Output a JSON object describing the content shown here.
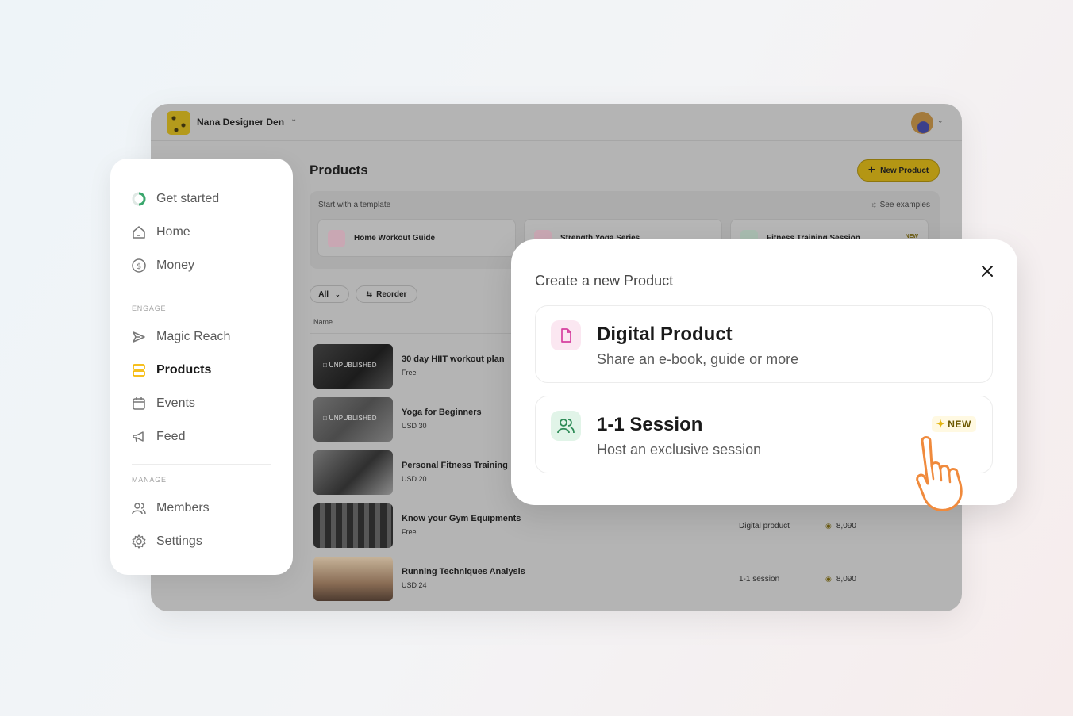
{
  "workspace": {
    "name": "Nana Designer Den"
  },
  "header": {
    "new_product_label": "New Product"
  },
  "page": {
    "title": "Products"
  },
  "templates": {
    "label": "Start with a template",
    "see_examples": "See examples",
    "items": [
      {
        "label": "Home Workout Guide",
        "badge": ""
      },
      {
        "label": "Strength Yoga Series",
        "badge": ""
      },
      {
        "label": "Fitness Training Session",
        "badge": "NEW"
      }
    ]
  },
  "filters": {
    "all_label": "All",
    "reorder_label": "Reorder"
  },
  "table": {
    "name_header": "Name",
    "rows": [
      {
        "title": "30 day HIIT workout plan",
        "price": "Free",
        "status": "UNPUBLISHED",
        "type": "",
        "views": ""
      },
      {
        "title": "Yoga for Beginners",
        "price": "USD 30",
        "status": "UNPUBLISHED",
        "type": "",
        "views": ""
      },
      {
        "title": "Personal Fitness Training",
        "price": "USD 20",
        "status": "",
        "type": "",
        "views": ""
      },
      {
        "title": "Know your Gym Equipments",
        "price": "Free",
        "status": "",
        "type": "Digital product",
        "views": "8,090"
      },
      {
        "title": "Running Techniques Analysis",
        "price": "USD 24",
        "status": "",
        "type": "1-1 session",
        "views": "8,090"
      }
    ]
  },
  "sidebar": {
    "items": [
      {
        "label": "Get started",
        "icon": "progress-icon"
      },
      {
        "label": "Home",
        "icon": "home-icon"
      },
      {
        "label": "Money",
        "icon": "dollar-icon"
      }
    ],
    "engage_label": "ENGAGE",
    "engage_items": [
      {
        "label": "Magic Reach",
        "icon": "send-icon"
      },
      {
        "label": "Products",
        "icon": "products-icon",
        "active": true
      },
      {
        "label": "Events",
        "icon": "calendar-icon"
      },
      {
        "label": "Feed",
        "icon": "megaphone-icon"
      }
    ],
    "manage_label": "MANAGE",
    "manage_items": [
      {
        "label": "Members",
        "icon": "users-icon"
      },
      {
        "label": "Settings",
        "icon": "gear-icon"
      }
    ]
  },
  "modal": {
    "title": "Create a new Product",
    "options": [
      {
        "title": "Digital Product",
        "subtitle": "Share an e-book, guide or more",
        "badge": ""
      },
      {
        "title": "1-1 Session",
        "subtitle": "Host an exclusive session",
        "badge": "NEW"
      }
    ]
  },
  "colors": {
    "accent": "#F5C518",
    "active_nav": "#F5B800",
    "pink_icon": "#D6409F",
    "green_icon": "#2E8B57"
  }
}
